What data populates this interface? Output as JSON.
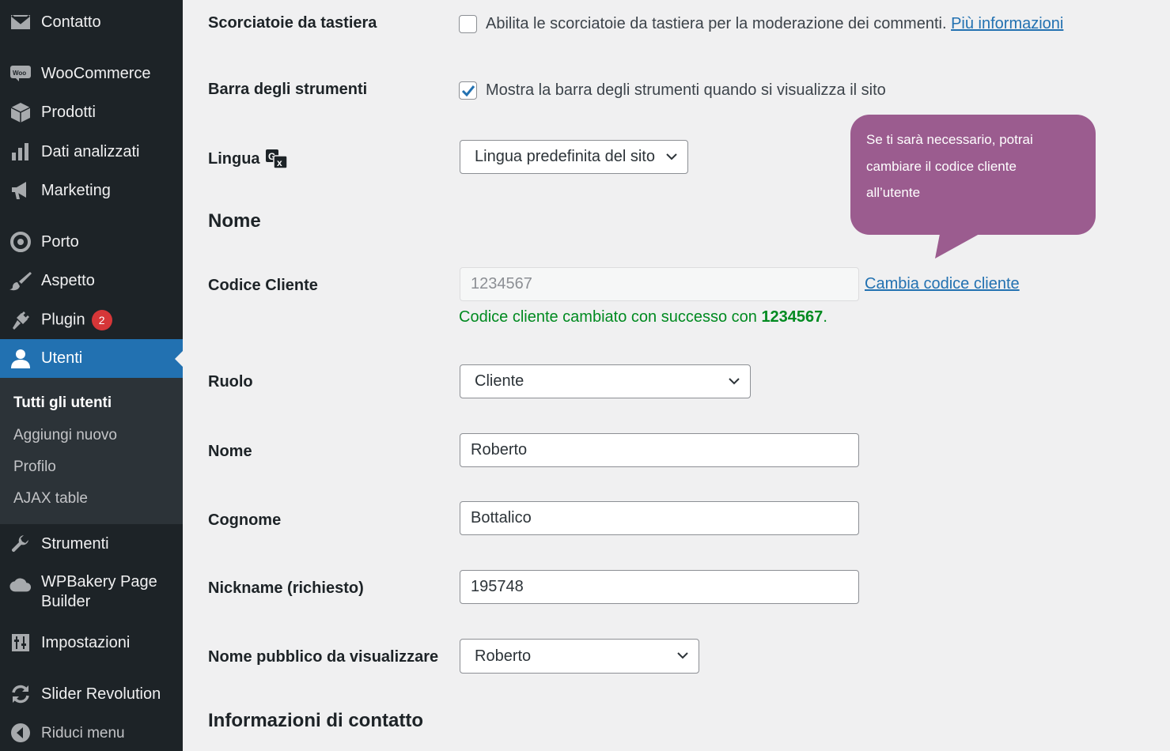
{
  "sidebar": {
    "items": [
      {
        "label": "Contatto",
        "icon": "envelope-icon"
      },
      {
        "label": "WooCommerce",
        "icon": "woocommerce-icon"
      },
      {
        "label": "Prodotti",
        "icon": "box-icon"
      },
      {
        "label": "Dati analizzati",
        "icon": "bar-chart-icon"
      },
      {
        "label": "Marketing",
        "icon": "megaphone-icon"
      },
      {
        "label": "Porto",
        "icon": "circle-icon"
      },
      {
        "label": "Aspetto",
        "icon": "paintbrush-icon"
      },
      {
        "label": "Plugin",
        "icon": "plugin-icon",
        "badge": "2"
      },
      {
        "label": "Utenti",
        "icon": "user-icon",
        "current": true
      },
      {
        "label": "Strumenti",
        "icon": "wrench-icon"
      },
      {
        "label": "WPBakery Page\nBuilder",
        "label_line1": "WPBakery Page",
        "label_line2": "Builder",
        "icon": "cloud-icon"
      },
      {
        "label": "Impostazioni",
        "icon": "sliders-icon"
      },
      {
        "label": "Slider Revolution",
        "icon": "refresh-icon"
      },
      {
        "label": "Riduci menu",
        "icon": "collapse-icon"
      }
    ],
    "submenu": [
      {
        "label": "Tutti gli utenti",
        "active": true
      },
      {
        "label": "Aggiungi nuovo"
      },
      {
        "label": "Profilo"
      },
      {
        "label": "AJAX table"
      }
    ]
  },
  "form": {
    "shortcuts": {
      "label": "Scorciatoie da tastiera",
      "checkbox_text": "Abilita le scorciatoie da tastiera per la moderazione dei commenti.",
      "link": "Più informazioni",
      "checked": false
    },
    "toolbar": {
      "label": "Barra degli strumenti",
      "checkbox_text": "Mostra la barra degli strumenti quando si visualizza il sito",
      "checked": true
    },
    "language": {
      "label": "Lingua",
      "value": "Lingua predefinita del sito"
    },
    "name_section": "Nome",
    "customer_code": {
      "label": "Codice Cliente",
      "value": "1234567",
      "link": "Cambia codice cliente",
      "success_prefix": "Codice cliente cambiato con successo con",
      "success_value": "1234567",
      "success_suffix": "."
    },
    "role": {
      "label": "Ruolo",
      "value": "Cliente"
    },
    "first_name": {
      "label": "Nome",
      "value": "Roberto"
    },
    "last_name": {
      "label": "Cognome",
      "value": "Bottalico"
    },
    "nickname": {
      "label": "Nickname (richiesto)",
      "value": "195748"
    },
    "display_name": {
      "label": "Nome pubblico da visualizzare",
      "value": "Roberto"
    },
    "contact_section": "Informazioni di contatto"
  },
  "tooltip": {
    "line1": "Se ti sarà necessario, potrai",
    "line2": "cambiare il codice cliente",
    "line3": "all’utente"
  },
  "colors": {
    "sidebar_bg": "#1d2327",
    "accent": "#2271b1",
    "tooltip": "#9b5c8f",
    "success": "#008a20",
    "badge": "#d63638"
  }
}
